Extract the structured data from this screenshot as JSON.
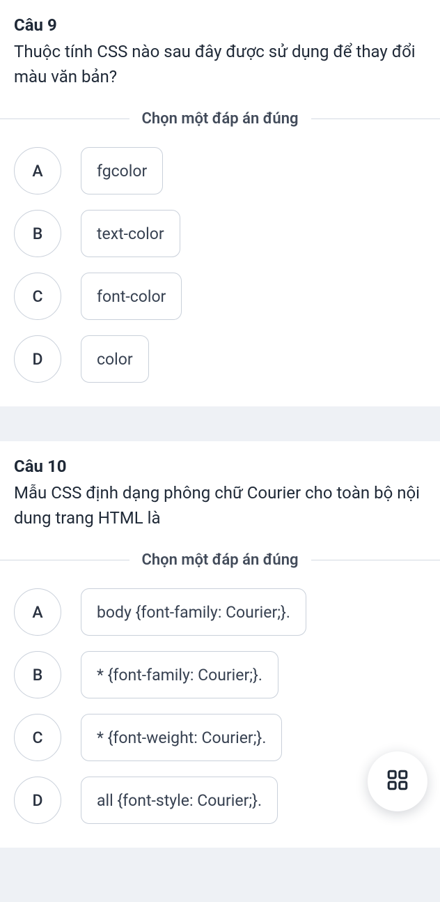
{
  "instruction_label": "Chọn một đáp án đúng",
  "questions": [
    {
      "title": "Câu 9",
      "text": "Thuộc tính CSS nào sau đây được sử dụng để thay đổi màu văn bản?",
      "options": [
        {
          "letter": "A",
          "text": "fgcolor"
        },
        {
          "letter": "B",
          "text": "text-color"
        },
        {
          "letter": "C",
          "text": "font-color"
        },
        {
          "letter": "D",
          "text": "color"
        }
      ]
    },
    {
      "title": "Câu 10",
      "text": "Mẫu CSS định dạng phông chữ Courier cho toàn bộ nội dung trang HTML là",
      "options": [
        {
          "letter": "A",
          "text": "body {font-family: Courier;}."
        },
        {
          "letter": "B",
          "text": "* {font-family: Courier;}."
        },
        {
          "letter": "C",
          "text": "* {font-weight: Courier;}."
        },
        {
          "letter": "D",
          "text": "all {font-style: Courier;}."
        }
      ]
    }
  ],
  "fab_icon_name": "grid-icon"
}
